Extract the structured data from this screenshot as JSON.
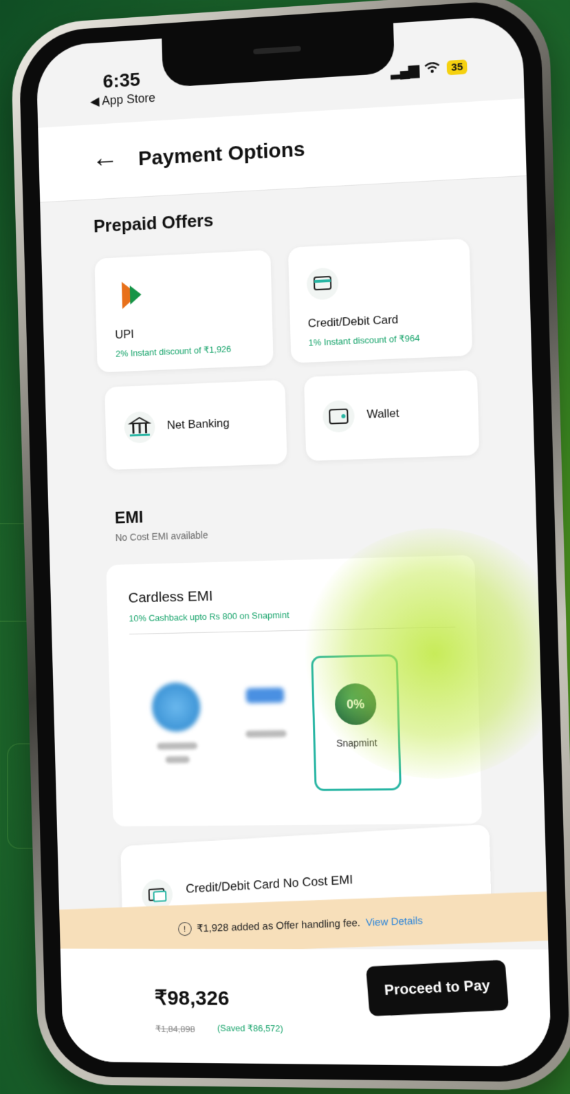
{
  "status_bar": {
    "time": "6:35",
    "back_app": "◀ App Store",
    "signal": "▂▄▆",
    "wifi": "WiFi",
    "battery": "35"
  },
  "header": {
    "back_icon": "←",
    "title": "Payment Options"
  },
  "prepaid": {
    "title": "Prepaid Offers",
    "options": [
      {
        "label": "UPI",
        "offer": "2% Instant discount of ₹1,926"
      },
      {
        "label": "Credit/Debit Card",
        "offer": "1% Instant discount of ₹964"
      },
      {
        "label": "Net Banking",
        "icon": "🏛"
      },
      {
        "label": "Wallet",
        "icon": "👛"
      }
    ]
  },
  "emi": {
    "title": "EMI",
    "subtitle": "No Cost EMI available",
    "cardless": {
      "title": "Cardless EMI",
      "offer": "10% Cashback upto Rs 800 on Snapmint",
      "selected_provider": "Snapmint",
      "snap_logo_text": "0%"
    },
    "card_emi": {
      "label": "Credit/Debit Card No Cost EMI",
      "icon": "💳"
    }
  },
  "fee_notice": {
    "info_icon": "!",
    "text": "₹1,928 added as Offer handling fee.",
    "link": "View Details"
  },
  "footer": {
    "price": "₹98,326",
    "mrp": "₹1,84,898",
    "saved": "(Saved ₹86,572)",
    "pay_button": "Proceed to Pay"
  },
  "colors": {
    "accent_green": "#15a36a",
    "snapmint_border": "#27b5a3",
    "fee_bar": "#f7dfba",
    "pay_button": "#0e0e0e"
  }
}
